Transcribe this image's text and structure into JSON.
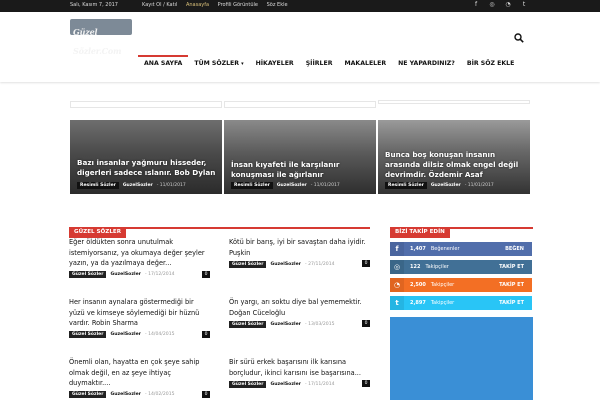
{
  "topbar": {
    "date": "Salı, Kasım 7, 2017",
    "links": [
      {
        "label": "Kayıt Ol / Katıl",
        "active": false
      },
      {
        "label": "Anasayfa",
        "active": true
      },
      {
        "label": "Profili Görüntüle",
        "active": false
      },
      {
        "label": "Söz Ekle",
        "active": false
      }
    ],
    "social_icons": [
      "facebook-icon",
      "instagram-icon",
      "rss-icon",
      "twitter-icon"
    ]
  },
  "header": {
    "logo_text": "Güzel Sözler.Com",
    "nav": [
      {
        "label": "ANA SAYFA",
        "active": true,
        "dropdown": false
      },
      {
        "label": "TÜM SÖZLER",
        "active": false,
        "dropdown": true
      },
      {
        "label": "HİKAYELER",
        "active": false,
        "dropdown": false
      },
      {
        "label": "ŞİİRLER",
        "active": false,
        "dropdown": false
      },
      {
        "label": "MAKALELER",
        "active": false,
        "dropdown": false
      },
      {
        "label": "NE YAPARDINIZ?",
        "active": false,
        "dropdown": false
      },
      {
        "label": "BİR SÖZ EKLE",
        "active": false,
        "dropdown": false
      }
    ]
  },
  "hero": [
    {
      "title": "Bazı insanlar yağmuru hisseder, digerleri sadece ıslanır. Bob Dylan",
      "tag": "Resimli Sözler",
      "author": "GuzelSozler",
      "date": "- 11/01/2017"
    },
    {
      "title": "İnsan kıyafeti ile karşılanır konuşması ile ağırlanır",
      "tag": "Resimli Sözler",
      "author": "GuzelSozler",
      "date": "- 11/01/2017"
    },
    {
      "title": "Bunca boş konuşan insanın arasında dilsiz olmak engel değil devrimdir. Özdemir Asaf",
      "tag": "Resimli Sözler",
      "author": "GuzelSozler",
      "date": "- 11/01/2017"
    }
  ],
  "sections": {
    "left_title": "GÜZEL SÖZLER",
    "right_title": "BİZİ TAKİP EDİN"
  },
  "articles_left": [
    {
      "title": "Eğer öldükten sonra unutulmak istemiyorsanız, ya okumaya değer şeyler yazın, ya da yazılmaya değer...",
      "tag": "Güzel Sözler",
      "author": "GuzelSozler",
      "date": "- 17/12/2014",
      "count": "0"
    },
    {
      "title": "Her insanın aynalara göstermediği bir yüzü ve kimseye söylemediği bir hüznü vardır. Robin Sharma",
      "tag": "Güzel Sözler",
      "author": "GuzelSozler",
      "date": "- 14/04/2015",
      "count": "0"
    },
    {
      "title": "Önemli olan, hayatta en çok şeye sahip olmak değil, en az şeye ihtiyaç duymaktır....",
      "tag": "Güzel Sözler",
      "author": "GuzelSozler",
      "date": "- 14/02/2015",
      "count": "0"
    }
  ],
  "articles_right": [
    {
      "title": "Kötü bir barış, iyi bir savaştan daha iyidir. Puşkin",
      "tag": "Güzel Sözler",
      "author": "GuzelSozler",
      "date": "- 27/11/2014",
      "count": "0"
    },
    {
      "title": "Ön yargı, arı soktu diye bal yememektir. Doğan Cüceloğlu",
      "tag": "Güzel Sözler",
      "author": "GuzelSozler",
      "date": "- 13/03/2015",
      "count": "0"
    },
    {
      "title": "Bir sürü erkek başarısını ilk karısına borçludur, ikinci karısını ise başarısına...",
      "tag": "Güzel Sözler",
      "author": "GuzelSozler",
      "date": "- 17/11/2014",
      "count": "0"
    }
  ],
  "social_widgets": [
    {
      "icon": "facebook-icon",
      "glyph": "f",
      "count": "1,407",
      "label": "Beğenenler",
      "action": "BEĞEN",
      "color": "#516eab",
      "icon_color": "#4a659e"
    },
    {
      "icon": "instagram-icon",
      "glyph": "◎",
      "count": "122",
      "label": "Takipçiler",
      "action": "TAKİP ET",
      "color": "#417096",
      "icon_color": "#3a6688"
    },
    {
      "icon": "rss-icon",
      "glyph": "◔",
      "count": "2,500",
      "label": "Takipçiler",
      "action": "TAKİP ET",
      "color": "#f36f24",
      "icon_color": "#e06520"
    },
    {
      "icon": "twitter-icon",
      "glyph": "t",
      "count": "2,897",
      "label": "Takipçiler",
      "action": "TAKİP ET",
      "color": "#29c5f6",
      "icon_color": "#25b5e3"
    }
  ],
  "colors": {
    "accent": "#d63a32",
    "topbar": "#1a1a1a"
  }
}
